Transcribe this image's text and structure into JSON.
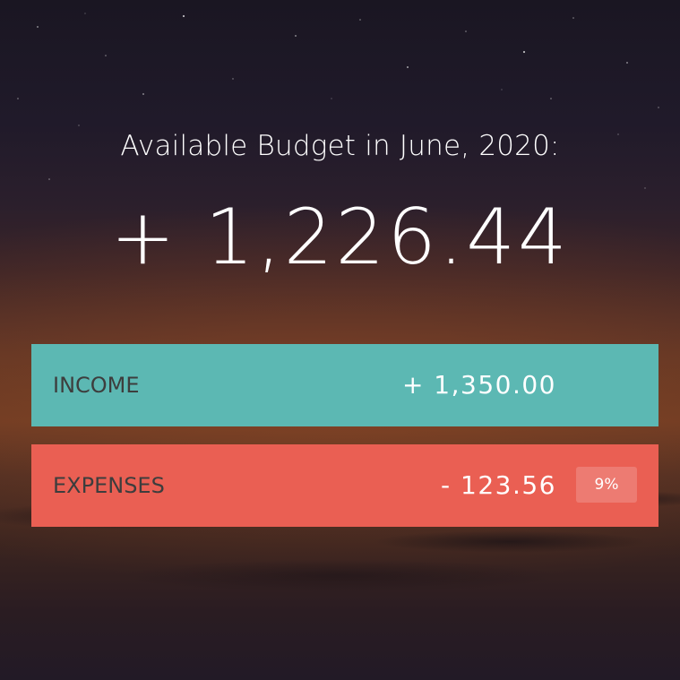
{
  "header": {
    "title": "Available Budget in June, 2020:",
    "budget": "+ 1,226.44"
  },
  "summary": {
    "income": {
      "label": "INCOME",
      "value": "+ 1,350.00",
      "color": "#5cb8b3"
    },
    "expenses": {
      "label": "EXPENSES",
      "value": "- 123.56",
      "percentage": "9%",
      "color": "#ea5f53"
    }
  }
}
